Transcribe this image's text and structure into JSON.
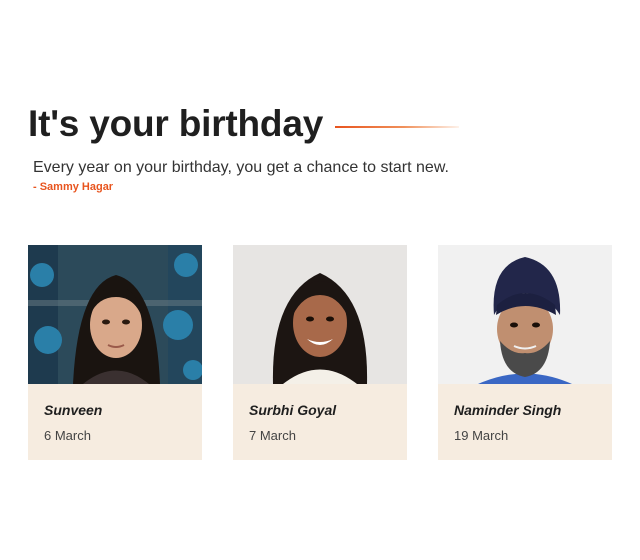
{
  "section": {
    "title": "It's your birthday",
    "quote": "Every year on your birthday, you get a chance to start new.",
    "author": "- Sammy Hagar"
  },
  "accent_color": "#e8541e",
  "card_background": "#f6ece0",
  "people": [
    {
      "name": "Sunveen",
      "date": "6 March"
    },
    {
      "name": "Surbhi Goyal",
      "date": "7 March"
    },
    {
      "name": "Naminder Singh",
      "date": "19 March"
    }
  ]
}
